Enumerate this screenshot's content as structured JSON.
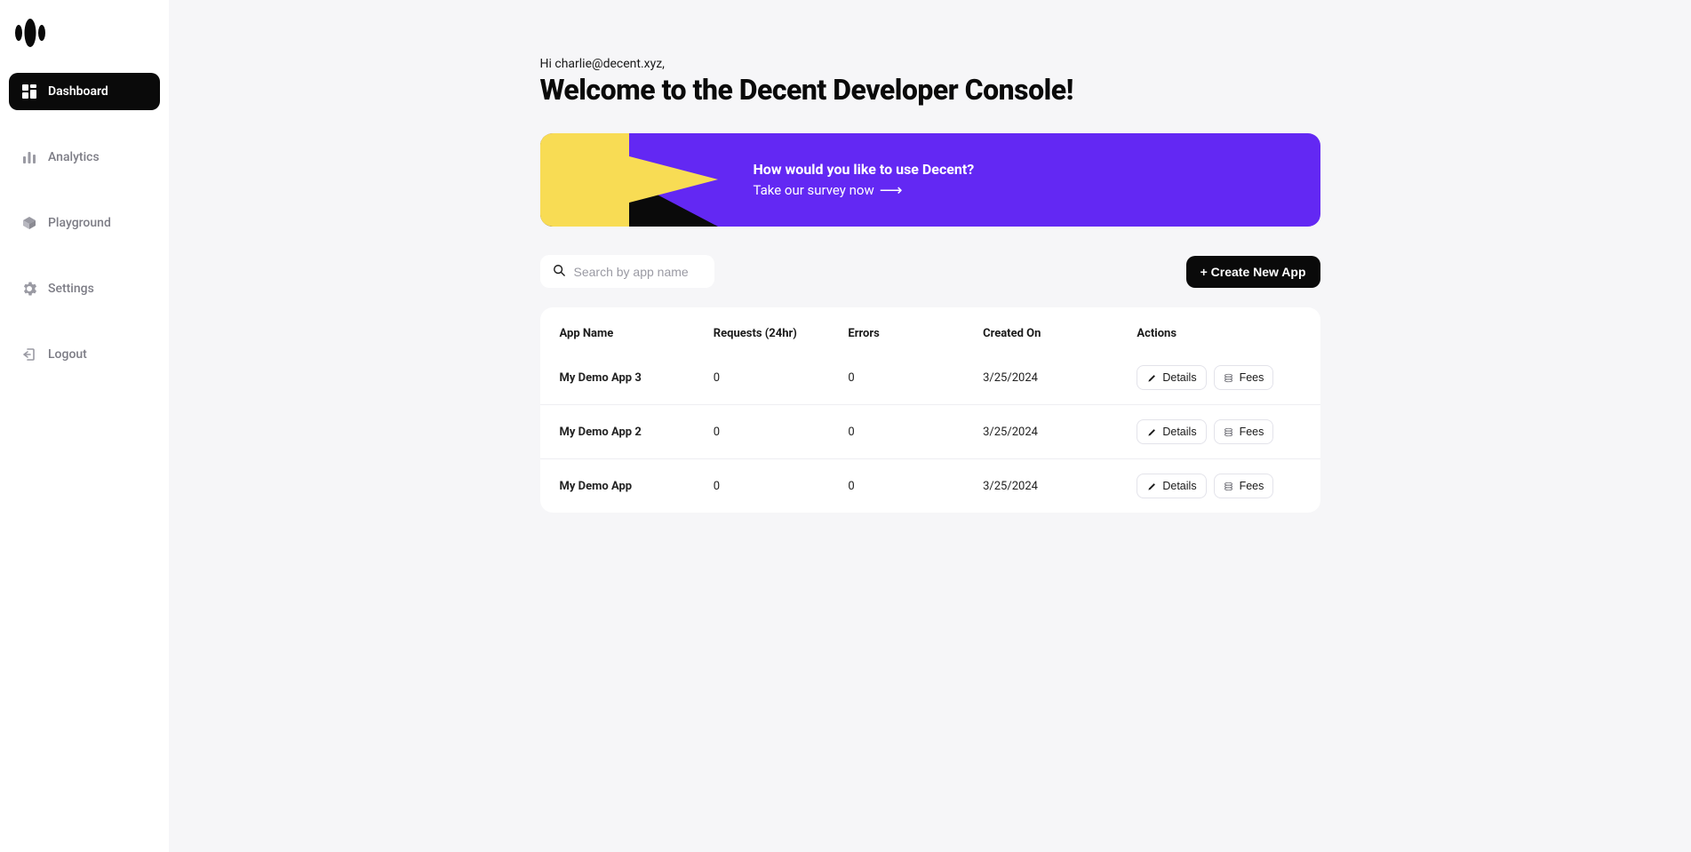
{
  "sidebar": {
    "items": [
      {
        "label": "Dashboard"
      },
      {
        "label": "Analytics"
      },
      {
        "label": "Playground"
      },
      {
        "label": "Settings"
      },
      {
        "label": "Logout"
      }
    ]
  },
  "header": {
    "greeting": "Hi charlie@decent.xyz,",
    "welcome": "Welcome to the Decent Developer Console!"
  },
  "banner": {
    "title": "How would you like to use Decent?",
    "subtitle": "Take our survey now"
  },
  "toolbar": {
    "search_placeholder": "Search by app name",
    "create_label": "+ Create New App"
  },
  "table": {
    "columns": {
      "app_name": "App Name",
      "requests": "Requests (24hr)",
      "errors": "Errors",
      "created": "Created On",
      "actions": "Actions"
    },
    "action_labels": {
      "details": "Details",
      "fees": "Fees"
    },
    "rows": [
      {
        "name": "My Demo App 3",
        "requests": "0",
        "errors": "0",
        "created": "3/25/2024"
      },
      {
        "name": "My Demo App 2",
        "requests": "0",
        "errors": "0",
        "created": "3/25/2024"
      },
      {
        "name": "My Demo App",
        "requests": "0",
        "errors": "0",
        "created": "3/25/2024"
      }
    ]
  },
  "colors": {
    "accent_purple": "#6328f3",
    "accent_yellow": "#f8dc54",
    "black": "#0a0a0a"
  }
}
